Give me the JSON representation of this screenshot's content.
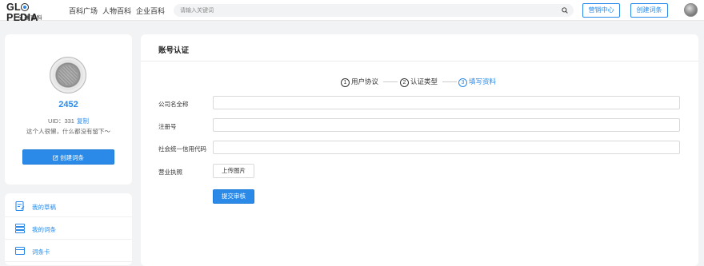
{
  "header": {
    "logo_text_pre": "GL",
    "logo_text_post": "PEDIA",
    "logo_sub": "全球百科",
    "nav": [
      "百科广场",
      "人物百科",
      "企业百科"
    ],
    "search_placeholder": "请输入关键词",
    "marketing_label": "营销中心",
    "create_label": "创建词条"
  },
  "profile": {
    "username": "2452",
    "uid_label": "UID：",
    "uid_value": "331",
    "copy_label": "复制",
    "bio": "这个人很懒，什么都没有留下～",
    "create_label": "创建词条"
  },
  "menu": [
    {
      "label": "我的草稿",
      "icon": "draft-icon"
    },
    {
      "label": "我的词条",
      "icon": "entries-icon"
    },
    {
      "label": "词条卡",
      "icon": "card-icon"
    }
  ],
  "main": {
    "title": "账号认证",
    "steps": [
      {
        "num": "1",
        "label": "用户协议",
        "active": false
      },
      {
        "num": "2",
        "label": "认证类型",
        "active": false
      },
      {
        "num": "3",
        "label": "填写资料",
        "active": true
      }
    ],
    "fields": [
      {
        "label": "公司名全称",
        "value": ""
      },
      {
        "label": "注册号",
        "value": ""
      },
      {
        "label": "社会统一信用代码",
        "value": ""
      }
    ],
    "license_label": "营业执照",
    "upload_label": "上传图片",
    "submit_label": "提交审核"
  },
  "colors": {
    "accent": "#2b8ae8",
    "background": "#f2f3f5"
  }
}
